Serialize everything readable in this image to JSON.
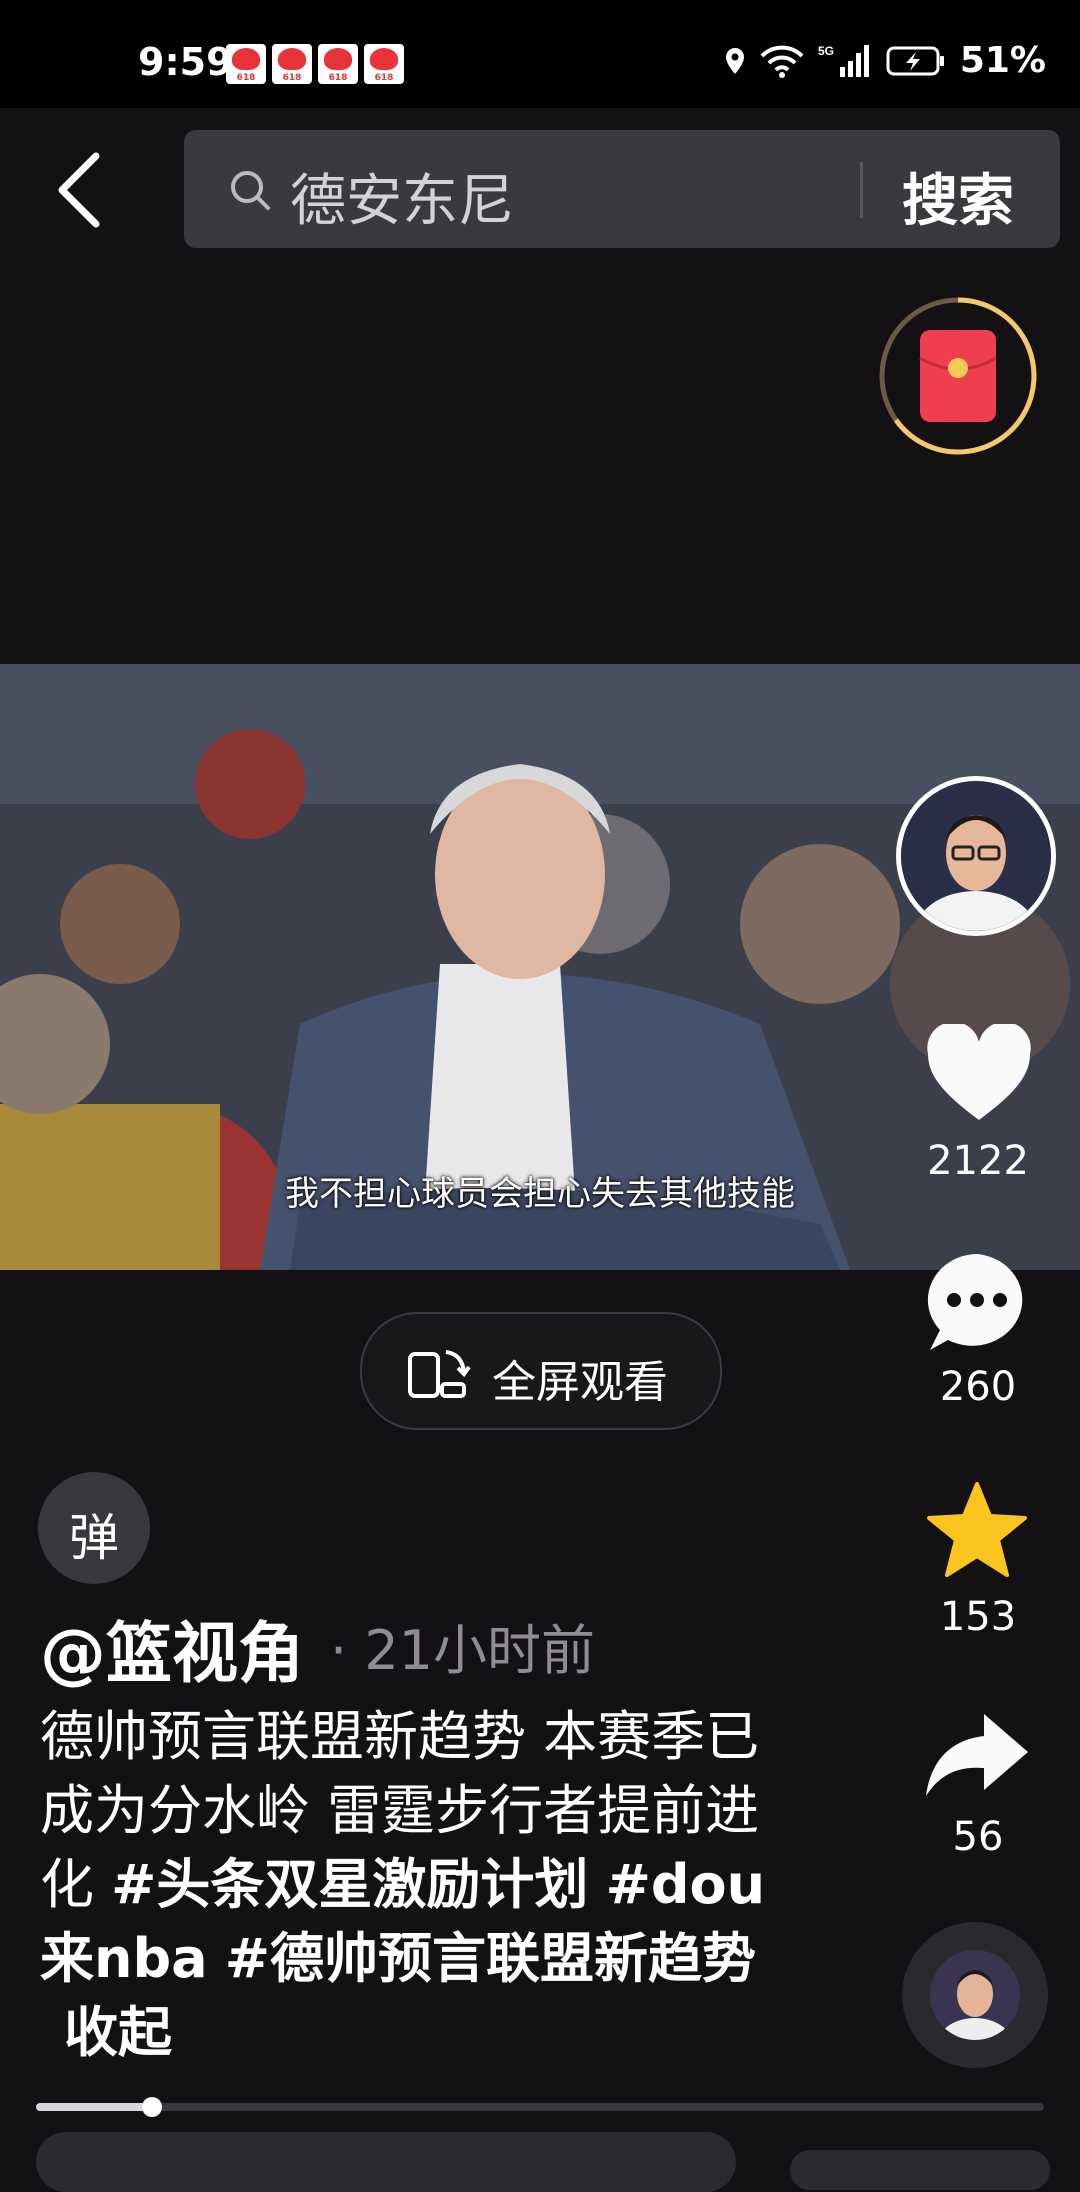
{
  "status_bar": {
    "time": "9:59",
    "badges": [
      "618",
      "618",
      "618",
      "618"
    ],
    "signal": "5G",
    "battery": "51%"
  },
  "search": {
    "query": "德安东尼",
    "button_label": "搜索"
  },
  "video": {
    "subtitle": "我不担心球员会担心失去其他技能"
  },
  "fullscreen": {
    "label": "全屏观看"
  },
  "danmu": {
    "label": "弹"
  },
  "actions": {
    "likes": "2122",
    "comments": "260",
    "favorites": "153",
    "shares": "56"
  },
  "post": {
    "author": "@篮视角",
    "time": "· 21小时前",
    "caption_text": "德帅预言联盟新趋势 本赛季已成为分水岭 雷霆步行者提前进化 ",
    "tags": [
      "#头条双星激励计划",
      "#dou来nba",
      "#德帅预言联盟新趋势"
    ],
    "collapse_label": "收起"
  },
  "progress": {
    "fraction": 0.115
  },
  "colors": {
    "background": "#141115",
    "star": "#fcc41f",
    "red_packet": "#ee3e4f",
    "ring": "#f5c86a"
  }
}
